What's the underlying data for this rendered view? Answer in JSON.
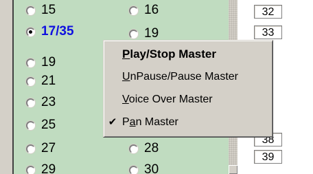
{
  "radio_grid": {
    "left_column": [
      {
        "label": "15",
        "selected": false
      },
      {
        "label": "17/35",
        "selected": true
      },
      {
        "label": "19",
        "selected": false
      },
      {
        "label": "21",
        "selected": false
      },
      {
        "label": "23",
        "selected": false
      },
      {
        "label": "25",
        "selected": false
      },
      {
        "label": "27",
        "selected": false
      },
      {
        "label": "29",
        "selected": false
      }
    ],
    "right_column": [
      {
        "label": "16",
        "selected": false
      },
      {
        "label": "19",
        "selected": false
      },
      {
        "label": "28",
        "selected": false
      },
      {
        "label": "30",
        "selected": false
      }
    ]
  },
  "number_list": [
    "32",
    "33",
    "38",
    "39"
  ],
  "context_menu": {
    "items": [
      {
        "pre": "",
        "accel": "P",
        "post": "lay/Stop Master",
        "default": true,
        "checked": false
      },
      {
        "pre": "",
        "accel": "U",
        "post": "nPause/Pause Master",
        "default": false,
        "checked": false
      },
      {
        "pre": "",
        "accel": "V",
        "post": "oice Over Master",
        "default": false,
        "checked": false
      },
      {
        "pre": "P",
        "accel": "a",
        "post": "n Master",
        "default": false,
        "checked": true
      }
    ],
    "check_glyph": "✔"
  },
  "colors": {
    "panel_green": "#c0dcc0",
    "selected_text": "#1010e0",
    "menu_face": "#d4d0c8"
  }
}
